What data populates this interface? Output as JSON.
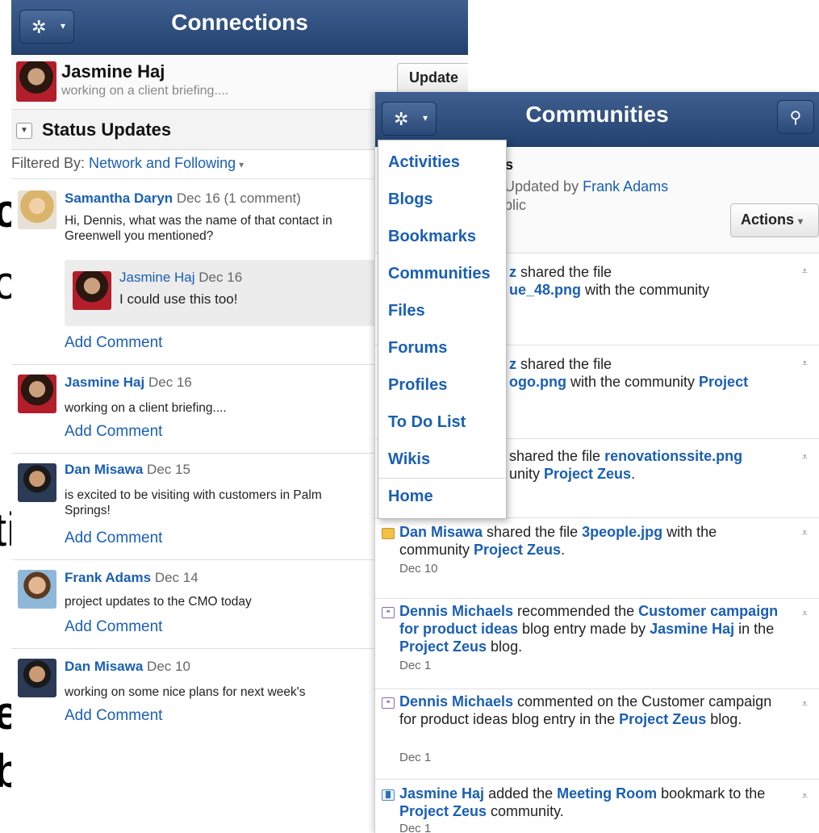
{
  "background_fragments": [
    "c",
    "c",
    "ti",
    "e",
    "ble"
  ],
  "connections": {
    "title": "Connections",
    "menu_glyph": "✲",
    "caret": "▾",
    "me": {
      "name": "Jasmine Haj",
      "status": "working on a client briefing...."
    },
    "update_label": "Update",
    "section_title": "Status Updates",
    "filter_prefix": "Filtered By: ",
    "filter_value": "Network and Following",
    "posts": [
      {
        "name": "Samantha Daryn",
        "meta": "Dec 16 (1 comment)",
        "line1": "Hi, Dennis, what was the name of that contact in",
        "line2": "Greenwell you mentioned?",
        "reply": {
          "name": "Jasmine Haj",
          "date": "Dec 16",
          "text": "I could use this too!"
        },
        "add_comment": "Add Comment"
      },
      {
        "name": "Jasmine Haj",
        "meta": "Dec 16",
        "line1": "working on a client briefing....",
        "add_comment": "Add Comment"
      },
      {
        "name": "Dan Misawa",
        "meta": "Dec 15",
        "line1": "is excited to be visiting with customers in Palm",
        "line2": "Springs!",
        "add_comment": "Add Comment"
      },
      {
        "name": "Frank Adams",
        "meta": "Dec 14",
        "line1": "project updates to the CMO today",
        "add_comment": "Add Comment"
      },
      {
        "name": "Dan Misawa",
        "meta": "Dec 10",
        "line1": "working on some nice plans for next week's",
        "add_comment": "Add Comment"
      }
    ]
  },
  "communities": {
    "title": "Communities",
    "search_glyph": "⚲",
    "community_name": "us",
    "updated_by_prefix": "I Updated by ",
    "updated_by": "Frank Adams",
    "visibility": "ublic",
    "actions_label": "Actions",
    "feed": [
      {
        "pre_bold": "z",
        "text1": " shared the file",
        "bold2": "ue_48.png",
        "text2": " with the community",
        "date": ""
      },
      {
        "pre_bold": "z",
        "text1": " shared the file",
        "bold2": "ogo.png",
        "text2": " with the community ",
        "bold3": "Project",
        "date": ""
      },
      {
        "text1": "shared the file ",
        "bold2": "renovationssite.png",
        "text2": "unity ",
        "bold3": "Project Zeus",
        "text3": ".",
        "date": ""
      },
      {
        "actor": "Dan Misawa",
        "text1": " shared the file ",
        "bold2": "3people.jpg",
        "text2": " with the community ",
        "bold3": "Project Zeus",
        "text3": ".",
        "date": "Dec 10"
      },
      {
        "actor": "Dennis Michaels",
        "text1": " recommended the ",
        "bold2": "Customer campaign for product ideas",
        "text2": " blog entry made by ",
        "bold3": "Jasmine Haj",
        "text3": " in the ",
        "bold4": "Project Zeus",
        "text4": " blog.",
        "date": "Dec 1"
      },
      {
        "actor": "Dennis Michaels",
        "text1": " commented on the Customer campaign for product ideas blog entry in the ",
        "bold2": "Project Zeus",
        "text2": " blog.",
        "date": "Dec 1"
      },
      {
        "actor": "Jasmine Haj",
        "text1": " added the ",
        "bold2": "Meeting Room",
        "text2": " bookmark to the ",
        "bold3": "Project Zeus",
        "text3": " community.",
        "date": "Dec 1"
      }
    ],
    "menu": [
      "Activities",
      "Blogs",
      "Bookmarks",
      "Communities",
      "Files",
      "Forums",
      "Profiles",
      "To Do List",
      "Wikis",
      "Home"
    ],
    "expand_glyph": "⩡"
  }
}
